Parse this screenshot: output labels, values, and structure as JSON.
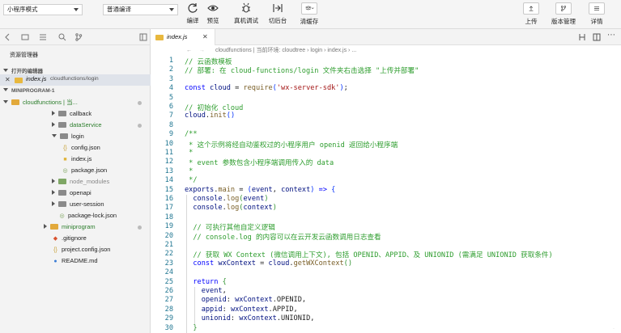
{
  "toolbar": {
    "mode_select": "小程序模式",
    "compile_select": "普通编译",
    "buttons": {
      "compile": "编译",
      "preview": "预览",
      "remote_debug": "真机调试",
      "background": "切后台",
      "clear_cache": "清缓存",
      "upload": "上传",
      "version": "版本管理",
      "details": "详情"
    }
  },
  "explorer": {
    "title": "资源管理器",
    "open_editors_header": "打开的编辑器",
    "open_file": {
      "name": "index.js",
      "path": "cloudfunctions/login"
    },
    "project_header": "MINIPROGRAM-1",
    "tree": [
      {
        "label": "cloudfunctions | 当...",
        "type": "folder-open",
        "color": "#e2a93b"
      },
      {
        "label": "callback",
        "type": "folder"
      },
      {
        "label": "dataService",
        "type": "folder"
      },
      {
        "label": "login",
        "type": "folder-open"
      },
      {
        "label": "config.json",
        "type": "json"
      },
      {
        "label": "index.js",
        "type": "js"
      },
      {
        "label": "package.json",
        "type": "json"
      },
      {
        "label": "node_modules",
        "type": "folder"
      },
      {
        "label": "openapi",
        "type": "folder"
      },
      {
        "label": "user-session",
        "type": "folder"
      },
      {
        "label": "package-lock.json",
        "type": "json"
      },
      {
        "label": "miniprogram",
        "type": "folder"
      },
      {
        "label": ".gitignore",
        "type": "git"
      },
      {
        "label": "project.config.json",
        "type": "json"
      },
      {
        "label": "README.md",
        "type": "md"
      }
    ]
  },
  "editor": {
    "tab": "index.js",
    "breadcrumb": "cloudfunctions | 当前环境: cloudtree  ›  login  ›  index.js  ›  ...",
    "lines": [
      {
        "n": "1",
        "parts": [
          [
            "c-com",
            "// 云函数模板"
          ]
        ]
      },
      {
        "n": "2",
        "parts": [
          [
            "c-com",
            "// 部署: 在 cloud-functions/login 文件夹右击选择 \"上传并部署\""
          ]
        ]
      },
      {
        "n": "3",
        "parts": []
      },
      {
        "n": "4",
        "parts": [
          [
            "c-kw",
            "const "
          ],
          [
            "c-var",
            "cloud"
          ],
          [
            "c-def",
            " = "
          ],
          [
            "c-fn",
            "require"
          ],
          [
            "c-br1",
            "("
          ],
          [
            "c-str",
            "'wx-server-sdk'"
          ],
          [
            "c-br1",
            ")"
          ],
          [
            "c-def",
            ";"
          ]
        ]
      },
      {
        "n": "5",
        "parts": []
      },
      {
        "n": "6",
        "parts": [
          [
            "c-com",
            "// 初始化 cloud"
          ]
        ]
      },
      {
        "n": "7",
        "parts": [
          [
            "c-var",
            "cloud"
          ],
          [
            "c-def",
            "."
          ],
          [
            "c-fn",
            "init"
          ],
          [
            "c-br1",
            "()"
          ]
        ]
      },
      {
        "n": "8",
        "parts": []
      },
      {
        "n": "9",
        "parts": [
          [
            "c-com",
            "/**"
          ]
        ]
      },
      {
        "n": "10",
        "parts": [
          [
            "c-com",
            " * 这个示例将经自动鉴权过的小程序用户 openid 返回给小程序端"
          ]
        ]
      },
      {
        "n": "11",
        "parts": [
          [
            "c-com",
            " *"
          ]
        ]
      },
      {
        "n": "12",
        "parts": [
          [
            "c-com",
            " * event 参数包含小程序端调用传入的 data"
          ]
        ]
      },
      {
        "n": "13",
        "parts": [
          [
            "c-com",
            " *"
          ]
        ]
      },
      {
        "n": "14",
        "parts": [
          [
            "c-com",
            " */"
          ]
        ]
      },
      {
        "n": "15",
        "parts": [
          [
            "c-var",
            "exports"
          ],
          [
            "c-def",
            "."
          ],
          [
            "c-fn",
            "main"
          ],
          [
            "c-def",
            " = "
          ],
          [
            "c-br1",
            "("
          ],
          [
            "c-var",
            "event"
          ],
          [
            "c-def",
            ", "
          ],
          [
            "c-var",
            "context"
          ],
          [
            "c-br1",
            ")"
          ],
          [
            "c-kw",
            " => "
          ],
          [
            "c-br1",
            "{"
          ]
        ]
      },
      {
        "n": "16",
        "parts": [
          [
            "c-def",
            "  "
          ],
          [
            "c-var",
            "console"
          ],
          [
            "c-def",
            "."
          ],
          [
            "c-fn",
            "log"
          ],
          [
            "c-br2",
            "("
          ],
          [
            "c-var",
            "event"
          ],
          [
            "c-br2",
            ")"
          ]
        ]
      },
      {
        "n": "17",
        "parts": [
          [
            "c-def",
            "  "
          ],
          [
            "c-var",
            "console"
          ],
          [
            "c-def",
            "."
          ],
          [
            "c-fn",
            "log"
          ],
          [
            "c-br2",
            "("
          ],
          [
            "c-var",
            "context"
          ],
          [
            "c-br2",
            ")"
          ]
        ]
      },
      {
        "n": "18",
        "parts": []
      },
      {
        "n": "19",
        "parts": [
          [
            "c-com",
            "  // 可执行其他自定义逻辑"
          ]
        ]
      },
      {
        "n": "20",
        "parts": [
          [
            "c-com",
            "  // console.log 的内容可以在云开发云函数调用日志查看"
          ]
        ]
      },
      {
        "n": "21",
        "parts": []
      },
      {
        "n": "22",
        "parts": [
          [
            "c-com",
            "  // 获取 WX Context (微信调用上下文), 包括 OPENID、APPID、及 UNIONID (需满足 UNIONID 获取条件)"
          ]
        ]
      },
      {
        "n": "23",
        "parts": [
          [
            "c-kw",
            "  const "
          ],
          [
            "c-var",
            "wxContext"
          ],
          [
            "c-def",
            " = "
          ],
          [
            "c-var",
            "cloud"
          ],
          [
            "c-def",
            "."
          ],
          [
            "c-fn",
            "getWXContext"
          ],
          [
            "c-br2",
            "()"
          ]
        ]
      },
      {
        "n": "24",
        "parts": []
      },
      {
        "n": "25",
        "parts": [
          [
            "c-kw",
            "  return "
          ],
          [
            "c-br2",
            "{"
          ]
        ]
      },
      {
        "n": "26",
        "parts": [
          [
            "c-def",
            "    "
          ],
          [
            "c-var",
            "event"
          ],
          [
            "c-def",
            ","
          ]
        ]
      },
      {
        "n": "27",
        "parts": [
          [
            "c-def",
            "    "
          ],
          [
            "c-var",
            "openid"
          ],
          [
            "c-def",
            ": "
          ],
          [
            "c-var",
            "wxContext"
          ],
          [
            "c-def",
            ".OPENID,"
          ]
        ]
      },
      {
        "n": "28",
        "parts": [
          [
            "c-def",
            "    "
          ],
          [
            "c-var",
            "appid"
          ],
          [
            "c-def",
            ": "
          ],
          [
            "c-var",
            "wxContext"
          ],
          [
            "c-def",
            ".APPID,"
          ]
        ]
      },
      {
        "n": "29",
        "parts": [
          [
            "c-def",
            "    "
          ],
          [
            "c-var",
            "unionid"
          ],
          [
            "c-def",
            ": "
          ],
          [
            "c-var",
            "wxContext"
          ],
          [
            "c-def",
            ".UNIONID,"
          ]
        ]
      },
      {
        "n": "30",
        "parts": [
          [
            "c-def",
            "  "
          ],
          [
            "c-br2",
            "}"
          ]
        ]
      }
    ]
  }
}
